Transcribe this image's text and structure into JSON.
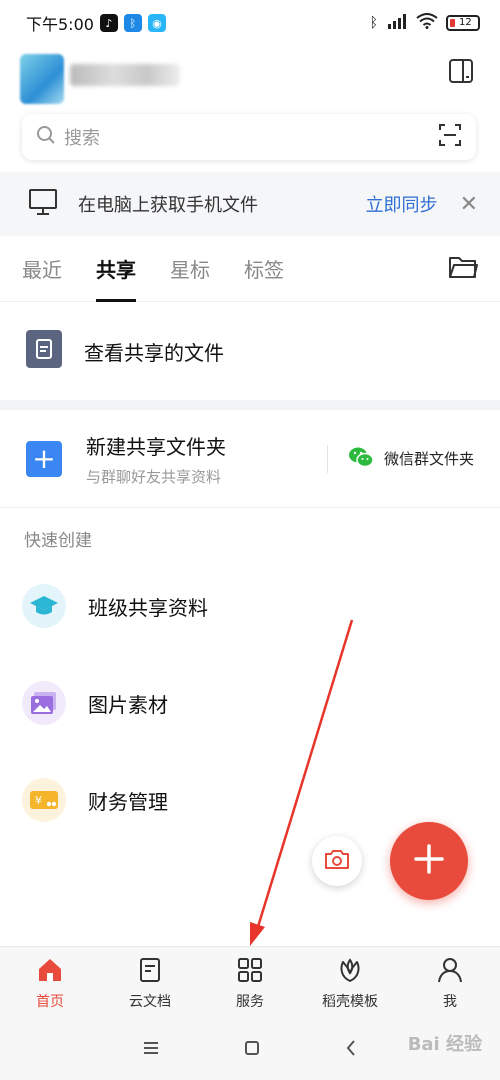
{
  "status_bar": {
    "time": "下午5:00",
    "battery": "12",
    "signal_label": "HD"
  },
  "search": {
    "placeholder": "搜索"
  },
  "sync_banner": {
    "text": "在电脑上获取手机文件",
    "action": "立即同步"
  },
  "tabs": [
    {
      "label": "最近",
      "active": false
    },
    {
      "label": "共享",
      "active": true
    },
    {
      "label": "星标",
      "active": false
    },
    {
      "label": "标签",
      "active": false
    }
  ],
  "shared_files": {
    "label": "查看共享的文件"
  },
  "new_share": {
    "title": "新建共享文件夹",
    "subtitle": "与群聊好友共享资料",
    "wechat_label": "微信群文件夹"
  },
  "quick_create": {
    "title": "快速创建",
    "items": [
      {
        "label": "班级共享资料",
        "icon": "graduation-cap-icon",
        "color": "#2bb6d6"
      },
      {
        "label": "图片素材",
        "icon": "image-icon",
        "color": "#9b6ee0"
      },
      {
        "label": "财务管理",
        "icon": "money-card-icon",
        "color": "#f4b52a"
      }
    ]
  },
  "bottom_nav": [
    {
      "label": "首页",
      "icon": "home-icon",
      "active": true
    },
    {
      "label": "云文档",
      "icon": "document-icon",
      "active": false
    },
    {
      "label": "服务",
      "icon": "grid-icon",
      "active": false
    },
    {
      "label": "稻壳模板",
      "icon": "leaf-icon",
      "active": false
    },
    {
      "label": "我",
      "icon": "person-icon",
      "active": false
    }
  ],
  "colors": {
    "accent": "#e84a3b",
    "link": "#2f6fd6",
    "plus_blue": "#3a86f2"
  }
}
